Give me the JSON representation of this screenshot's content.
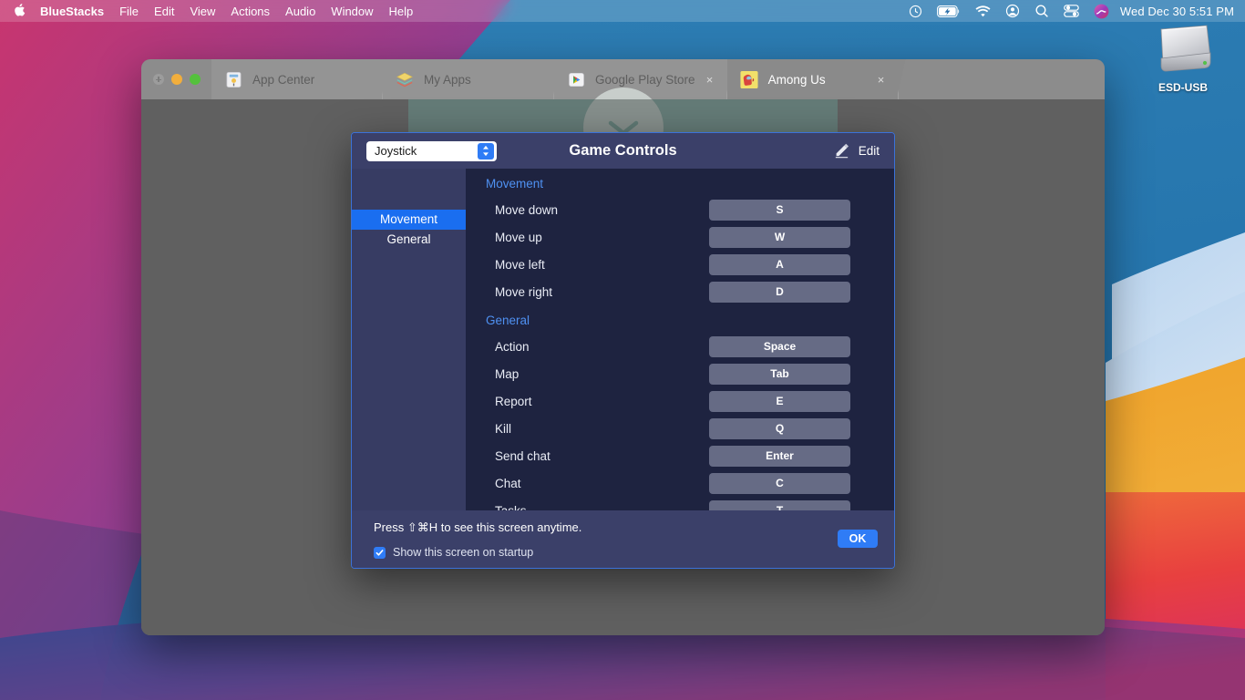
{
  "menubar": {
    "apple_icon": "apple-logo",
    "items": [
      {
        "label": "BlueStacks",
        "bold": true
      },
      {
        "label": "File",
        "bold": false
      },
      {
        "label": "Edit",
        "bold": false
      },
      {
        "label": "View",
        "bold": false
      },
      {
        "label": "Actions",
        "bold": false
      },
      {
        "label": "Audio",
        "bold": false
      },
      {
        "label": "Window",
        "bold": false
      },
      {
        "label": "Help",
        "bold": false
      }
    ],
    "status_icons": [
      "clock-icon",
      "battery-charging-icon",
      "wifi-icon",
      "user-account-icon",
      "search-icon",
      "control-center-icon",
      "siri-icon"
    ],
    "clock": "Wed Dec 30  5:51 PM"
  },
  "desktop": {
    "drive": {
      "icon": "external-drive-icon",
      "label": "ESD-USB"
    }
  },
  "bluestacks": {
    "traffic_lights": [
      "close",
      "minimize",
      "maximize"
    ],
    "tabs": [
      {
        "label": "App Center",
        "icon": "app-center-icon",
        "active": false,
        "closable": false
      },
      {
        "label": "My Apps",
        "icon": "my-apps-icon",
        "active": false,
        "closable": false
      },
      {
        "label": "Google Play Store",
        "icon": "google-play-icon",
        "active": false,
        "closable": true,
        "close_label": "×"
      },
      {
        "label": "Among Us",
        "icon": "among-us-icon",
        "active": true,
        "closable": true,
        "close_label": "×"
      }
    ],
    "app_strip": {
      "collapse_icon": "chevron-down-icon"
    }
  },
  "dialog": {
    "profile_select": {
      "value": "Joystick",
      "stepper_icon": "up-down-stepper-icon"
    },
    "title": "Game Controls",
    "edit": {
      "icon": "pencil-edit-icon",
      "label": "Edit"
    },
    "sidebar": [
      {
        "label": "Movement",
        "active": true
      },
      {
        "label": "General",
        "active": false
      }
    ],
    "sections": [
      {
        "title": "Movement",
        "controls": [
          {
            "name": "Move down",
            "key": "S"
          },
          {
            "name": "Move up",
            "key": "W"
          },
          {
            "name": "Move left",
            "key": "A"
          },
          {
            "name": "Move right",
            "key": "D"
          }
        ]
      },
      {
        "title": "General",
        "controls": [
          {
            "name": "Action",
            "key": "Space"
          },
          {
            "name": "Map",
            "key": "Tab"
          },
          {
            "name": "Report",
            "key": "E"
          },
          {
            "name": "Kill",
            "key": "Q"
          },
          {
            "name": "Send chat",
            "key": "Enter"
          },
          {
            "name": "Chat",
            "key": "C"
          },
          {
            "name": "Tasks",
            "key": "T"
          }
        ]
      }
    ],
    "footer": {
      "hint": "Press ⇧⌘H to see this screen anytime.",
      "checkbox_label": "Show this screen on startup",
      "checkbox_checked": true,
      "checkbox_mark": "✓",
      "ok_label": "OK"
    }
  },
  "colors": {
    "accent_blue": "#2f7cf6",
    "dialog_bg": "#1e2340",
    "dialog_header": "#3b4069",
    "sidebar_active": "#1a6ef0",
    "section_title": "#4f91f2",
    "key_button": "#666b85"
  }
}
